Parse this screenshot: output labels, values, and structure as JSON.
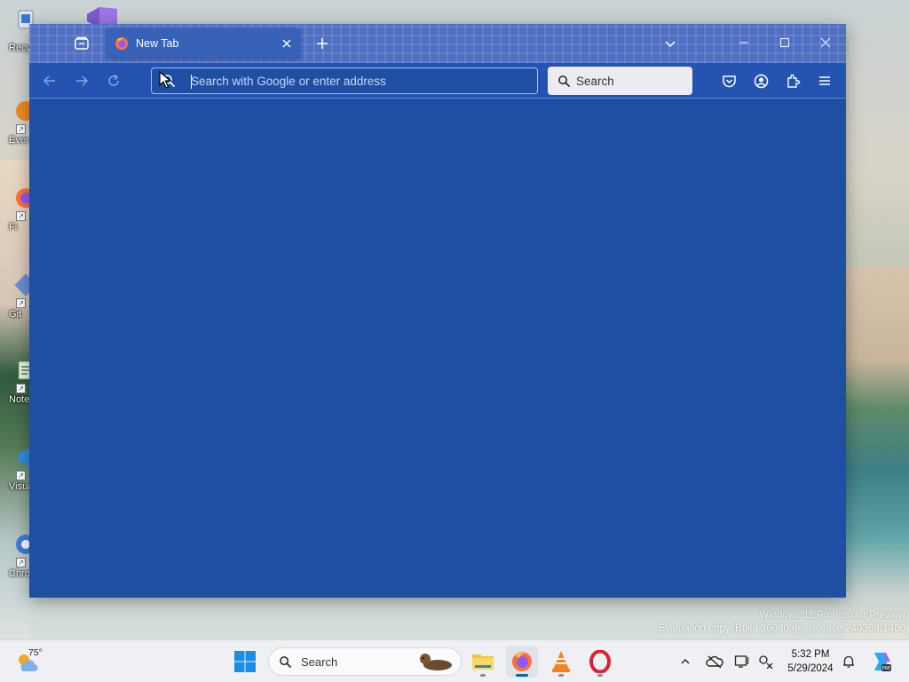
{
  "desktop": {
    "icons": [
      {
        "label": "Recy",
        "icon": "recycle-bin-icon"
      },
      {
        "label": "Ever",
        "icon": "everything-icon"
      },
      {
        "label": "Fi",
        "icon": "firefox-icon"
      },
      {
        "label": "Git",
        "icon": "git-icon"
      },
      {
        "label": "Note",
        "icon": "notepad-icon"
      },
      {
        "label": "Visua",
        "icon": "visual-studio-code-icon"
      },
      {
        "label": "Chro",
        "icon": "chrome-icon"
      }
    ],
    "visual_studio_icon": "visual-studio-icon",
    "watermark": {
      "line1": "Windows 11 Pro Insider Preview",
      "line2": "Evaluation copy. Build 26080.ge_release.240308-1400"
    }
  },
  "browser": {
    "tab_group_icon": "tab-group-icon",
    "tab": {
      "title": "New Tab",
      "favicon": "firefox-icon",
      "close_icon": "close-icon"
    },
    "new_tab_icon": "plus-icon",
    "list_tabs_icon": "chevron-down-icon",
    "window_controls": [
      "minimize-icon",
      "maximize-icon",
      "close-icon"
    ],
    "nav": {
      "back_icon": "back-arrow-icon",
      "forward_icon": "forward-arrow-icon",
      "reload_icon": "reload-icon"
    },
    "urlbar": {
      "placeholder": "Search with Google or enter address",
      "value": "",
      "icon": "search-icon"
    },
    "searchbar": {
      "placeholder": "Search",
      "value": "",
      "icon": "search-icon"
    },
    "toolbar": [
      "pocket-icon",
      "account-icon",
      "extensions-icon",
      "menu-icon"
    ],
    "content_bg": "#1f4fa3"
  },
  "taskbar": {
    "weather": {
      "temp": "75°",
      "icon": "weather-icon"
    },
    "start_icon": "windows-start-icon",
    "search": {
      "label": "Search",
      "icon": "search-icon"
    },
    "apps": [
      {
        "name": "file-explorer",
        "icon": "folder-icon",
        "active": false
      },
      {
        "name": "firefox",
        "icon": "firefox-icon",
        "active": true
      },
      {
        "name": "vlc",
        "icon": "vlc-icon",
        "active": false
      },
      {
        "name": "opera",
        "icon": "opera-icon",
        "active": false
      }
    ],
    "tray": [
      "chevron-up-icon",
      "onedrive-offline-icon",
      "display-icon",
      "network-icon"
    ],
    "clock": {
      "time": "5:32 PM",
      "date": "5/29/2024"
    },
    "notification_icon": "bell-icon",
    "copilot_icon": "copilot-icon"
  },
  "colors": {
    "accent": "#1f4fa3",
    "titlebar": "#4f6fc3",
    "focus_ring": "#9fc1ff",
    "taskbar_bg": "#eef0f3"
  }
}
